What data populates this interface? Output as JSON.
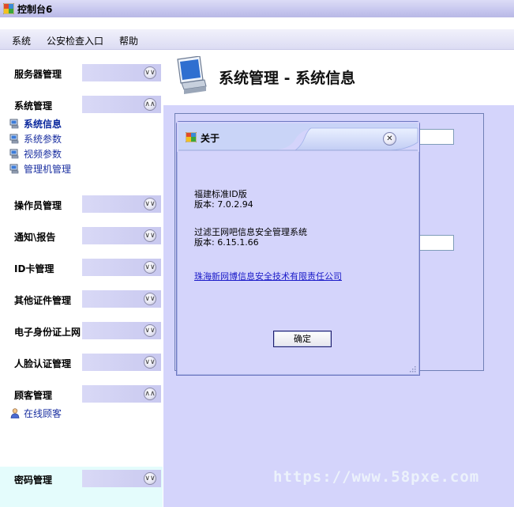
{
  "window": {
    "title": "控制台6"
  },
  "menubar": {
    "items": [
      "系统",
      "公安检查入口",
      "帮助"
    ]
  },
  "sidebar": {
    "groups": [
      {
        "label": "服务器管理",
        "state": "collapsed"
      },
      {
        "label": "系统管理",
        "state": "expanded",
        "items": [
          "系统信息",
          "系统参数",
          "视频参数",
          "管理机管理"
        ],
        "active": "系统信息"
      },
      {
        "label": "操作员管理",
        "state": "collapsed"
      },
      {
        "label": "通知\\报告",
        "state": "collapsed"
      },
      {
        "label": "ID卡管理",
        "state": "collapsed"
      },
      {
        "label": "其他证件管理",
        "state": "collapsed"
      },
      {
        "label": "电子身份证上网",
        "state": "collapsed"
      },
      {
        "label": "人脸认证管理",
        "state": "collapsed"
      },
      {
        "label": "顾客管理",
        "state": "expanded",
        "items": [
          "在线顾客"
        ]
      },
      {
        "label": "密码管理",
        "state": "collapsed"
      }
    ]
  },
  "main": {
    "page_title": "系统管理 - 系统信息"
  },
  "dialog": {
    "title": "关于",
    "product1_name": "福建标准ID版",
    "product1_version": "版本: 7.0.2.94",
    "product2_name": "过滤王网吧信息安全管理系统",
    "product2_version": "版本: 6.15.1.66",
    "company_link": "珠海新网博信息安全技术有限责任公司",
    "ok_label": "确定"
  },
  "watermark": "https://www.58pxe.com",
  "icons": {
    "app": "app-window-icon",
    "group_toggle_collapsed": "chevron-double-down-icon",
    "group_toggle_expanded": "chevron-double-up-icon",
    "sub_item": "computer-icon",
    "online_customer": "user-icon",
    "page": "computer-monitor-icon",
    "dialog_close": "close-icon"
  },
  "colors": {
    "content_bg": "#d4d4fb",
    "link": "#1a1ac8",
    "sub_item": "#1a2fa0"
  }
}
